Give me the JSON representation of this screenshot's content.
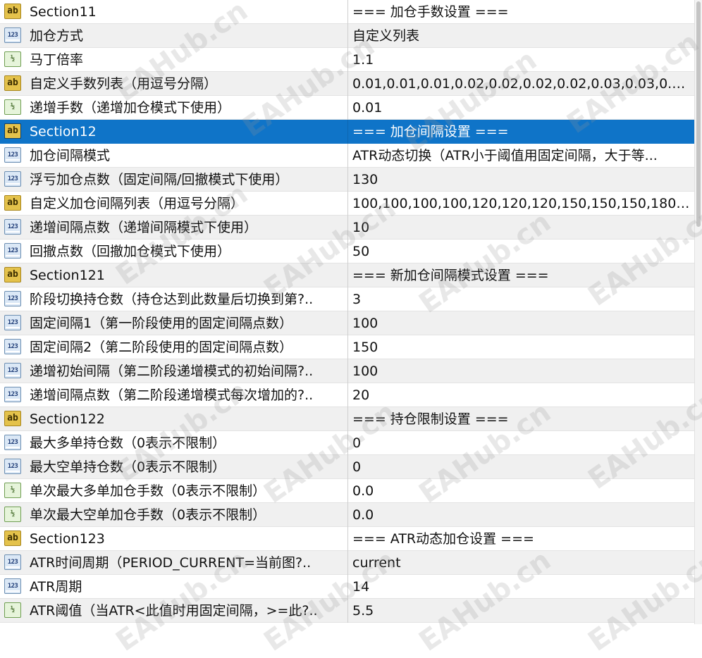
{
  "rows": [
    {
      "icon": "ab",
      "name": "Section11",
      "value": "=== 加仓手数设置 ==="
    },
    {
      "icon": "123",
      "name": "加仓方式",
      "value": "自定义列表"
    },
    {
      "icon": "½",
      "name": "马丁倍率",
      "value": "1.1"
    },
    {
      "icon": "ab",
      "name": "自定义手数列表（用逗号分隔）",
      "value": "0.01,0.01,0.01,0.02,0.02,0.02,0.02,0.03,0.03,0.03,..."
    },
    {
      "icon": "½",
      "name": "递增手数（递增加仓模式下使用）",
      "value": "0.01"
    },
    {
      "icon": "ab",
      "name": "Section12",
      "value": "=== 加仓间隔设置 ===",
      "selected": true
    },
    {
      "icon": "123",
      "name": "加仓间隔模式",
      "value": "ATR动态切换（ATR小于阈值用固定间隔，大于等..."
    },
    {
      "icon": "123",
      "name": "浮亏加仓点数（固定间隔/回撤模式下使用）",
      "value": "130"
    },
    {
      "icon": "ab",
      "name": "自定义加仓间隔列表（用逗号分隔）",
      "value": "100,100,100,100,120,120,120,150,150,150,180,..."
    },
    {
      "icon": "123",
      "name": "递增间隔点数（递增间隔模式下使用）",
      "value": "10"
    },
    {
      "icon": "123",
      "name": "回撤点数（回撤加仓模式下使用）",
      "value": "50"
    },
    {
      "icon": "ab",
      "name": "Section121",
      "value": "=== 新加仓间隔模式设置 ==="
    },
    {
      "icon": "123",
      "name": "阶段切换持仓数（持仓达到此数量后切换到第?..",
      "value": "3"
    },
    {
      "icon": "123",
      "name": "固定间隔1（第一阶段使用的固定间隔点数）",
      "value": "100"
    },
    {
      "icon": "123",
      "name": "固定间隔2（第二阶段使用的固定间隔点数）",
      "value": "150"
    },
    {
      "icon": "123",
      "name": "递增初始间隔（第二阶段递增模式的初始间隔?..",
      "value": "100"
    },
    {
      "icon": "123",
      "name": "递增间隔点数（第二阶段递增模式每次增加的?..",
      "value": "20"
    },
    {
      "icon": "ab",
      "name": "Section122",
      "value": "=== 持仓限制设置 ==="
    },
    {
      "icon": "123",
      "name": "最大多单持仓数（0表示不限制）",
      "value": "0"
    },
    {
      "icon": "123",
      "name": "最大空单持仓数（0表示不限制）",
      "value": "0"
    },
    {
      "icon": "½",
      "name": "单次最大多单加仓手数（0表示不限制）",
      "value": "0.0"
    },
    {
      "icon": "½",
      "name": "单次最大空单加仓手数（0表示不限制）",
      "value": "0.0"
    },
    {
      "icon": "ab",
      "name": "Section123",
      "value": "=== ATR动态加仓设置 ==="
    },
    {
      "icon": "123",
      "name": "ATR时间周期（PERIOD_CURRENT=当前图?..",
      "value": "current"
    },
    {
      "icon": "123",
      "name": "ATR周期",
      "value": "14"
    },
    {
      "icon": "½",
      "name": "ATR阈值（当ATR<此值时用固定间隔，>=此?..",
      "value": "5.5"
    }
  ],
  "watermark": "EAHub.cn",
  "colors": {
    "selected_bg": "#0f74c8",
    "alt_bg": "#f0f0f0"
  }
}
